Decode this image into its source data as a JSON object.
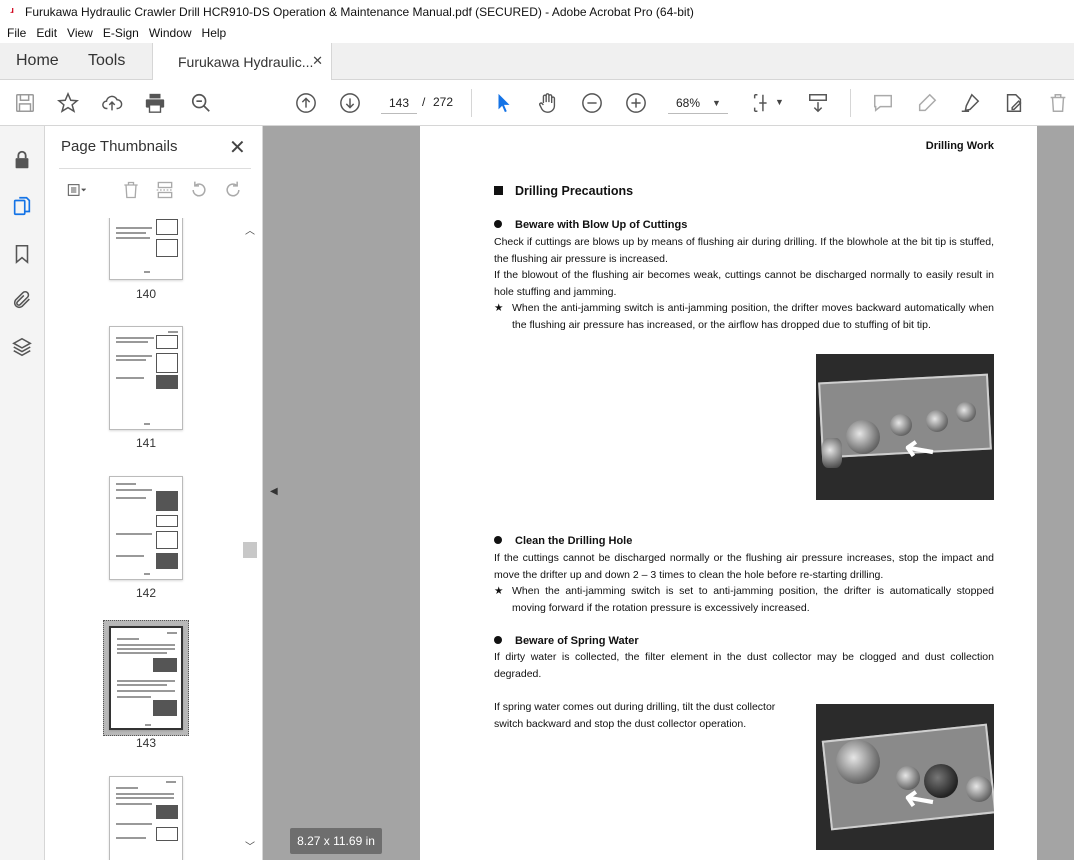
{
  "window": {
    "title": "Furukawa Hydraulic Crawler Drill HCR910-DS Operation & Maintenance Manual.pdf (SECURED) - Adobe Acrobat Pro (64-bit)"
  },
  "menu": {
    "items": [
      "File",
      "Edit",
      "View",
      "E-Sign",
      "Window",
      "Help"
    ]
  },
  "tabs": {
    "home": "Home",
    "tools": "Tools",
    "document": "Furukawa Hydraulic..."
  },
  "toolbar": {
    "current_page": "143",
    "page_separator": "/",
    "total_pages": "272",
    "zoom": "68%"
  },
  "thumbnails_panel": {
    "title": "Page Thumbnails",
    "pages": [
      {
        "label": "140"
      },
      {
        "label": "141"
      },
      {
        "label": "142"
      },
      {
        "label": "143",
        "selected": true
      }
    ]
  },
  "document": {
    "header": "Drilling Work",
    "section_title": "Drilling Precautions",
    "blocks": {
      "cuttings": {
        "heading": "Beware with Blow Up of Cuttings",
        "p1": "Check if cuttings are blows up by means of flushing air during drilling. If the blowhole at the bit tip is stuffed, the flushing air pressure is increased.",
        "p2": "If the blowout of the flushing air becomes weak, cuttings cannot be discharged normally to easily result in hole stuffing and jamming.",
        "note": "When the anti-jamming switch is anti-jamming position, the drifter moves backward automatically when the flushing air pressure has increased, or the airflow has dropped due to stuffing of bit tip."
      },
      "clean": {
        "heading": "Clean the Drilling Hole",
        "p1": "If the cuttings cannot be discharged normally or the flushing air pressure increases, stop the impact and move the drifter up and down 2 – 3 times to clean the hole before re-starting drilling.",
        "note": "When the anti-jamming switch is set to anti-jamming position, the drifter is automatically stopped moving forward if the rotation pressure is excessively increased."
      },
      "spring": {
        "heading": "Beware of Spring Water",
        "p1": "If dirty water is collected, the filter element in the dust collector may be clogged and dust collection degraded.",
        "p2": "If spring water comes out during drilling, tilt the dust collector switch backward and stop the dust collector operation."
      }
    },
    "note_marker": "★",
    "page_size": "8.27 x 11.69 in"
  },
  "icons": {
    "app": "acrobat-icon",
    "accent": "#1473e6"
  }
}
